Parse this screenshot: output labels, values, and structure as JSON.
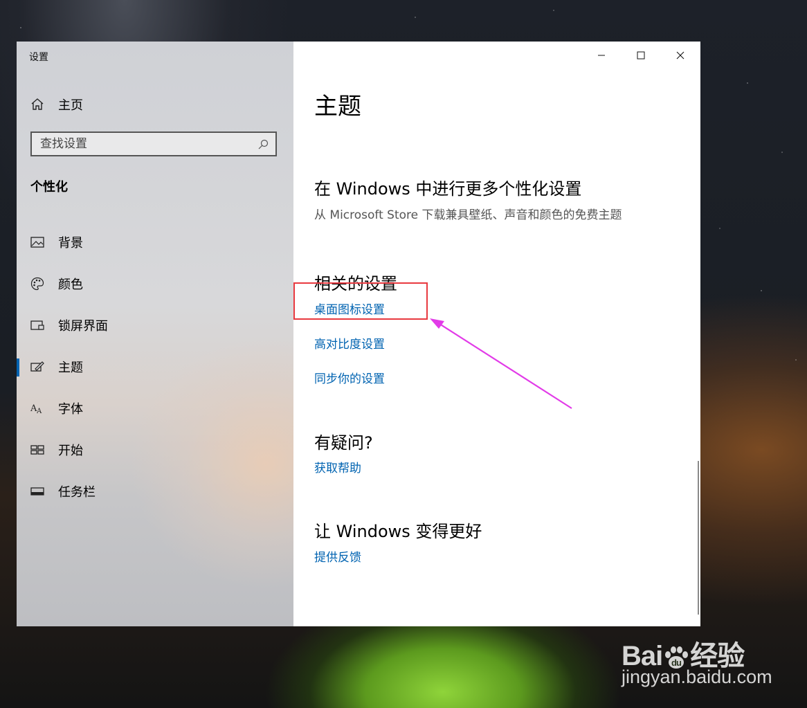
{
  "window": {
    "title": "设置",
    "controls": [
      "minimize-icon",
      "maximize-icon",
      "close-icon"
    ]
  },
  "sidebar": {
    "home_label": "主页",
    "search_placeholder": "查找设置",
    "section_heading": "个性化",
    "items": [
      {
        "label": "背景",
        "icon": "picture-icon",
        "active": false
      },
      {
        "label": "颜色",
        "icon": "palette-icon",
        "active": false
      },
      {
        "label": "锁屏界面",
        "icon": "lock-screen-icon",
        "active": false
      },
      {
        "label": "主题",
        "icon": "theme-brush-icon",
        "active": true
      },
      {
        "label": "字体",
        "icon": "font-icon",
        "active": false
      },
      {
        "label": "开始",
        "icon": "start-grid-icon",
        "active": false
      },
      {
        "label": "任务栏",
        "icon": "taskbar-icon",
        "active": false
      }
    ]
  },
  "main": {
    "title": "主题",
    "more_personalization": {
      "heading": "在 Windows 中进行更多个性化设置",
      "description": "从 Microsoft Store 下载兼具壁纸、声音和颜色的免费主题"
    },
    "related_settings": {
      "heading": "相关的设置",
      "links": [
        "桌面图标设置",
        "高对比度设置",
        "同步你的设置"
      ]
    },
    "questions": {
      "heading": "有疑问?",
      "link": "获取帮助"
    },
    "improve": {
      "heading": "让 Windows 变得更好",
      "link": "提供反馈"
    }
  },
  "watermark": {
    "logo_text": "Bai 经验",
    "url": "jingyan.baidu.com"
  },
  "colors": {
    "accent": "#0063b1",
    "annotation_box": "#e8393f",
    "annotation_arrow": "#e23be8"
  }
}
